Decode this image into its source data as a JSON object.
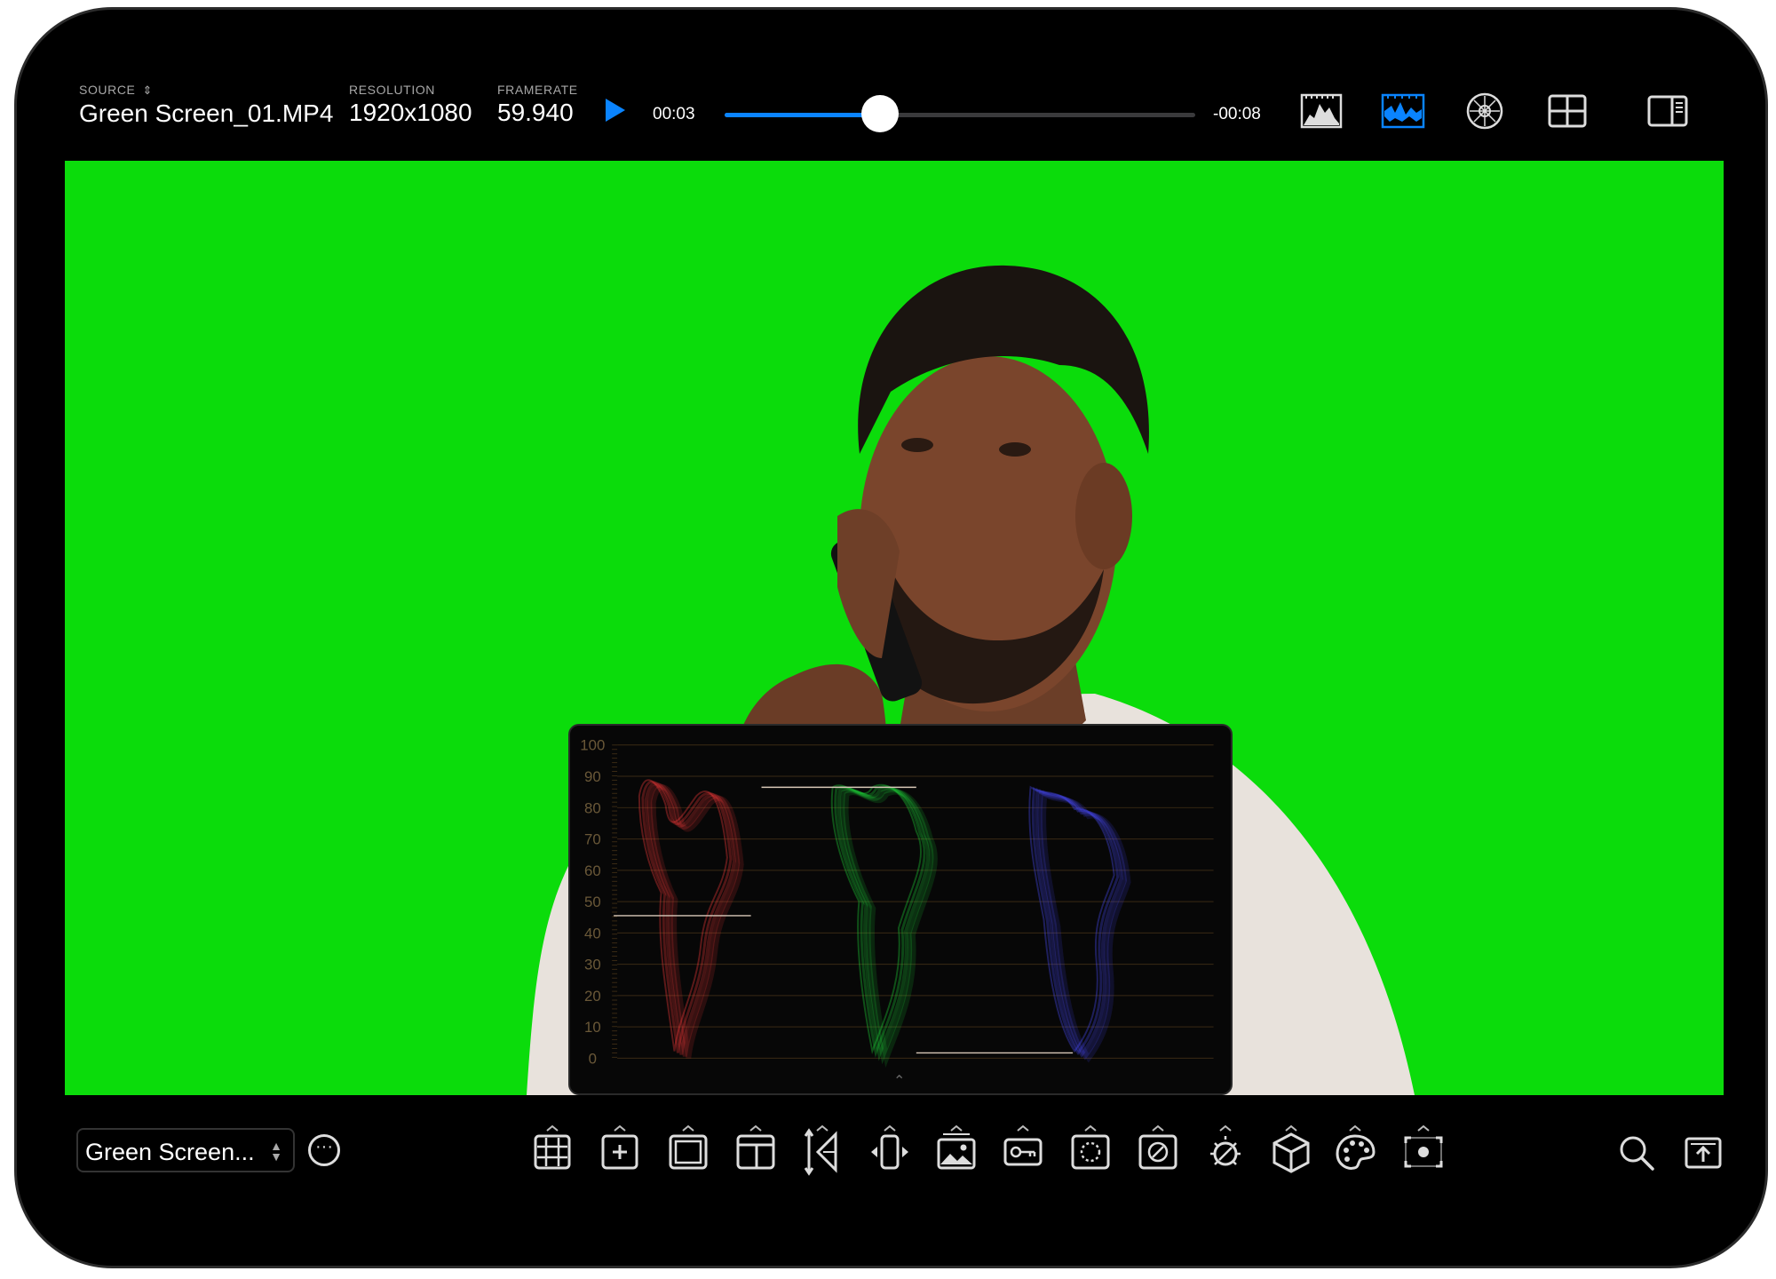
{
  "header": {
    "source_label": "SOURCE",
    "source_value": "Green Screen_01.MP4",
    "resolution_label": "RESOLUTION",
    "resolution_value": "1920x1080",
    "framerate_label": "FRAMERATE",
    "framerate_value": "59.940",
    "elapsed": "00:03",
    "remaining": "-00:08",
    "progress": 0.33,
    "icons": [
      "histogram-icon",
      "waveform-icon",
      "vectorscope-icon",
      "grid-layout-icon",
      "sidebar-icon"
    ],
    "active_icon": "waveform-icon"
  },
  "scope": {
    "scale_labels": [
      "100",
      "90",
      "80",
      "70",
      "60",
      "50",
      "40",
      "30",
      "20",
      "10",
      "0"
    ],
    "channels": [
      "red",
      "green",
      "blue"
    ]
  },
  "footer": {
    "source_short": "Green Screen...",
    "tools": [
      "grid-overlay-icon",
      "crosshair-icon",
      "frame-guide-icon",
      "safe-area-icon",
      "false-color-icon",
      "compare-icon",
      "image-overlay-icon",
      "key-icon",
      "zebra-icon",
      "focus-peaking-icon",
      "exposure-icon",
      "lut-cube-icon",
      "color-palette-icon",
      "record-frame-icon"
    ],
    "right_tools": [
      "zoom-icon",
      "export-icon"
    ]
  },
  "colors": {
    "accent": "#0a84ff",
    "chroma_green": "#0bdc0b",
    "background": "#000000"
  }
}
